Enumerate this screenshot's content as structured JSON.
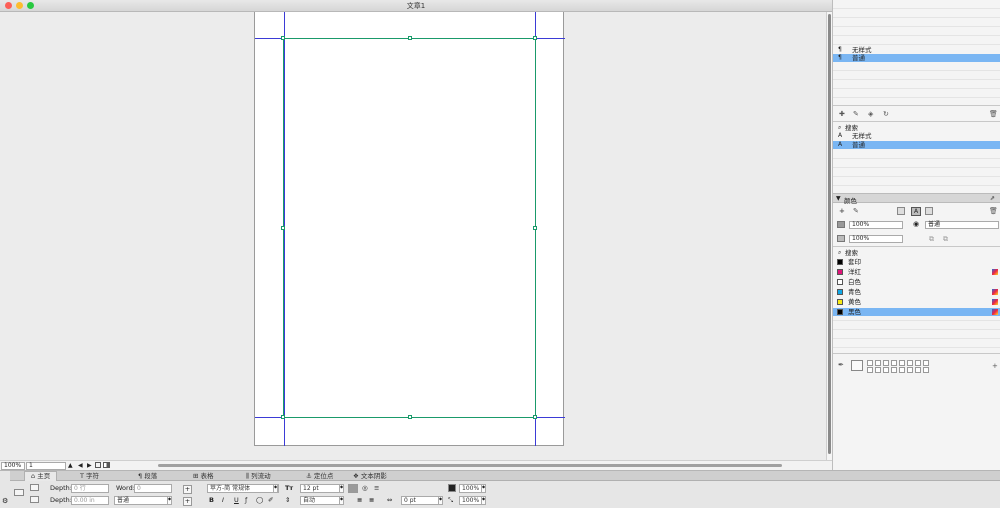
{
  "window": {
    "title": "文章1"
  },
  "statusbar": {
    "zoom": "100%",
    "page": "1"
  },
  "styles_panel": {
    "paragraph_styles": [
      {
        "label": "无样式",
        "selected": false
      },
      {
        "label": "普通",
        "selected": true
      }
    ],
    "character_search_placeholder": "搜索",
    "character_styles": [
      {
        "label": "无样式",
        "selected": false
      },
      {
        "label": "普通",
        "selected": true
      }
    ]
  },
  "colors_panel": {
    "title": "颜色",
    "tint_value": "100%",
    "opacity_value": "100%",
    "blend_mode": "普通",
    "search_placeholder": "搜索",
    "swatches": [
      {
        "label": "套印",
        "color": "#000000",
        "gradient": false,
        "selected": false
      },
      {
        "label": "洋红",
        "color": "#e0147a",
        "gradient": true,
        "selected": false
      },
      {
        "label": "白色",
        "color": "#ffffff",
        "gradient": false,
        "selected": false
      },
      {
        "label": "青色",
        "color": "#10a8e8",
        "gradient": true,
        "selected": false
      },
      {
        "label": "黄色",
        "color": "#f7ea14",
        "gradient": true,
        "selected": false
      },
      {
        "label": "黑色",
        "color": "#000000",
        "gradient": true,
        "selected": true
      }
    ]
  },
  "toolbar": {
    "tabs": [
      "主页",
      "字符",
      "段落",
      "表格",
      "列流动",
      "定位点",
      "文本阴影"
    ],
    "depth_label_1": "Depth:",
    "depth_value_1": "0 行",
    "depth_label_2": "Depth:",
    "depth_value_2": "0.00 in",
    "word_label": "Word:",
    "word_value": "0",
    "style_value": "普通",
    "font_value": "苹方-简 常规体",
    "font_size": "12 pt",
    "leading": "自动",
    "bold_label": "B",
    "italic_label": "I",
    "underline_label": "U",
    "tracking": "0 pt",
    "scale_h": "100%",
    "scale_v": "100%"
  },
  "accent_colors": {
    "selection": "#7ab6f3",
    "guides": "#3b3bd6",
    "frame": "#1a9a6a"
  }
}
